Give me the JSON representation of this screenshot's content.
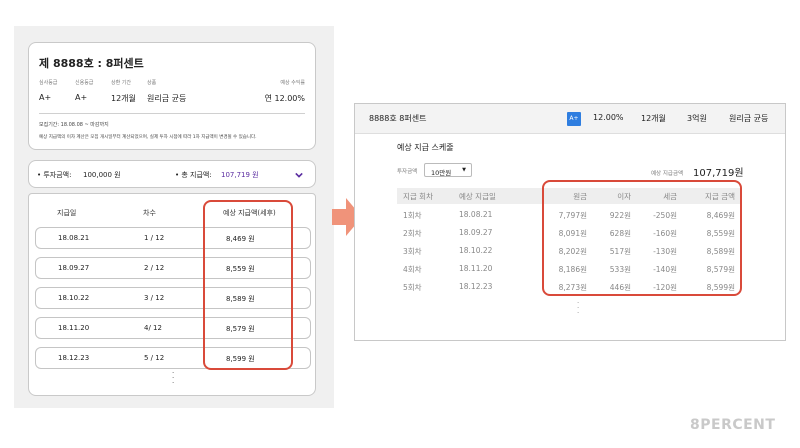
{
  "mobile": {
    "title": "제 8888호 : 8퍼센트",
    "info": {
      "headers": [
        "심사등급",
        "신용등급",
        "상환 기간",
        "상품",
        "예상 수익률"
      ],
      "values": [
        "A+",
        "A+",
        "12개월",
        "원리금 균등",
        "연 12.00%"
      ]
    },
    "period": "모집기간: 18.08.08 ~ 마감까지",
    "notice": "예상 지급액의 이자 계산은 모집 개시일부터 계산되었으며, 실제 투자 시점에 따라 1차 지급액이 변경될 수 있습니다.",
    "summary": {
      "invest_label": "• 투자금액:",
      "invest_value": "100,000 원",
      "total_label": "• 총 지급액:",
      "total_value": "107,719 원"
    },
    "columns": [
      "지급일",
      "차수",
      "예상 지급액(세후)"
    ],
    "rows": [
      {
        "date": "18.08.21",
        "round": "1 / 12",
        "amount": "8,469 원"
      },
      {
        "date": "18.09.27",
        "round": "2 / 12",
        "amount": "8,559 원"
      },
      {
        "date": "18.10.22",
        "round": "3 / 12",
        "amount": "8,589 원"
      },
      {
        "date": "18.11.20",
        "round": "4/ 12",
        "amount": "8,579 원"
      },
      {
        "date": "18.12.23",
        "round": "5 / 12",
        "amount": "8,599 원"
      }
    ]
  },
  "desktop": {
    "header": {
      "title": "8888호 8퍼센트",
      "badge": "A+",
      "rate": "12.00%",
      "period": "12개월",
      "amount": "3억원",
      "method": "원리금 균등"
    },
    "schedule_title": "예상 지급 스케줄",
    "invest_label": "투자금액",
    "invest_select": "10만원",
    "expected_label": "예상 지급금액",
    "expected_value": "107,719원",
    "columns": [
      "지급 회차",
      "예상 지급일",
      "원금",
      "이자",
      "세금",
      "지급 금액"
    ],
    "rows": [
      {
        "round": "1회차",
        "date": "18.08.21",
        "principal": "7,797원",
        "interest": "922원",
        "tax": "-250원",
        "payment": "8,469원"
      },
      {
        "round": "2회차",
        "date": "18.09.27",
        "principal": "8,091원",
        "interest": "628원",
        "tax": "-160원",
        "payment": "8,559원"
      },
      {
        "round": "3회차",
        "date": "18.10.22",
        "principal": "8,202원",
        "interest": "517원",
        "tax": "-130원",
        "payment": "8,589원"
      },
      {
        "round": "4회차",
        "date": "18.11.20",
        "principal": "8,186원",
        "interest": "533원",
        "tax": "-140원",
        "payment": "8,579원"
      },
      {
        "round": "5회차",
        "date": "18.12.23",
        "principal": "8,273원",
        "interest": "446원",
        "tax": "-120원",
        "payment": "8,599원"
      }
    ]
  },
  "brand": "8PERCENT",
  "colors": {
    "highlight": "#d94a3a",
    "arrow": "#f0937a",
    "badge": "#2f7ee0",
    "accent_purple": "#5a2ca0"
  },
  "icons": {
    "expand": "chevron-down-icon",
    "select": "caret-down-icon",
    "transition": "arrow-right-icon"
  }
}
